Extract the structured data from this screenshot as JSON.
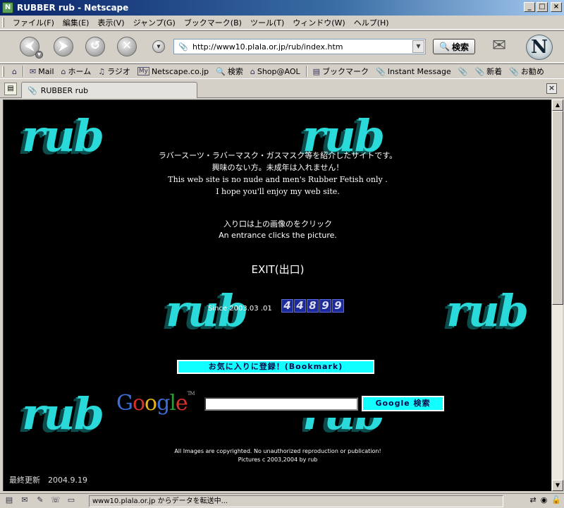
{
  "window": {
    "title": "RUBBER rub - Netscape",
    "app_icon": "N"
  },
  "menu": [
    "ファイル(F)",
    "編集(E)",
    "表示(V)",
    "ジャンプ(G)",
    "ブックマーク(B)",
    "ツール(T)",
    "ウィンドウ(W)",
    "ヘルプ(H)"
  ],
  "nav": {
    "url": "http://www10.plala.or.jp/rub/index.htm",
    "search_label": "検索",
    "back_glyph": "⮜",
    "forward_glyph": "⮞",
    "reload_glyph": "↺",
    "stop_glyph": "✕"
  },
  "personal_toolbar": {
    "items": [
      {
        "label": "Mail",
        "icon": "envelope-icon"
      },
      {
        "label": "ホーム",
        "icon": "home-icon"
      },
      {
        "label": "ラジオ",
        "icon": "headphones-icon"
      },
      {
        "label": "Netscape.co.jp",
        "icon": "my-icon"
      },
      {
        "label": "検索",
        "icon": "search-icon"
      },
      {
        "label": "Shop@AOL",
        "icon": "shop-icon"
      },
      {
        "label": "ブックマーク",
        "icon": "bookmark-icon"
      },
      {
        "label": "Instant Message",
        "icon": "pin-icon"
      },
      {
        "label": "新着",
        "icon": "pin-icon"
      },
      {
        "label": "お勧め",
        "icon": "pin-icon"
      }
    ],
    "my_badge": "My"
  },
  "tab": {
    "label": "RUBBER rub"
  },
  "page": {
    "logo_text": "rub",
    "intro_ja_1": "ラバースーツ・ラバーマスク・ガスマスク等を紹介したサイトです。",
    "intro_ja_2": "興味のない方。未成年は入れません！",
    "intro_en_1": "This web site is no nude and men's Rubber Fetish only .",
    "intro_en_2": "I hope you'll enjoy my web site.",
    "entrance_ja": "入り口は上の画像のをクリック",
    "entrance_en": "An entrance clicks the picture.",
    "exit_label": "EXIT(出口)",
    "since_label": "Since 2003.03 .01",
    "counter_digits": [
      "4",
      "4",
      "8",
      "9",
      "9"
    ],
    "bookmark_label": "お気に入りに登録！(Bookmark)",
    "google": {
      "letters": [
        "G",
        "o",
        "o",
        "g",
        "l",
        "e"
      ],
      "colors": [
        "#3b6fd6",
        "#d8322a",
        "#e8b31a",
        "#3b6fd6",
        "#2f9a3a",
        "#d8322a"
      ],
      "tm": "TM",
      "search_button": "Google 検索",
      "query": ""
    },
    "copyright_1": "All Images are copyrighted. No unauthorized reproduction or publication!",
    "copyright_2": "Pictures c 2003,2004 by rub",
    "updated": "最終更新　2004.9.19"
  },
  "status": {
    "text": "www10.plala.or.jp からデータを転送中..."
  }
}
